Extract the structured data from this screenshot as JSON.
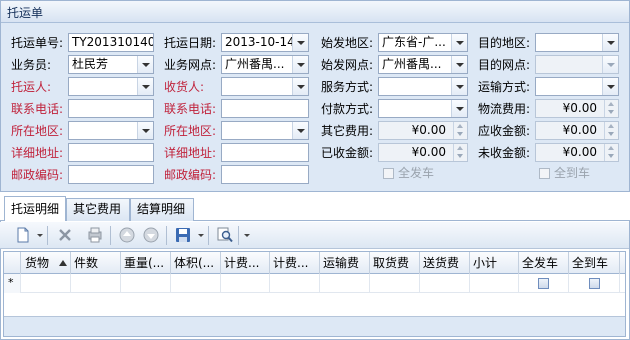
{
  "panel": {
    "title": "托运单"
  },
  "form": {
    "waybill_no_label": "托运单号:",
    "waybill_no_value": "TY201310140",
    "ship_date_label": "托运日期:",
    "ship_date_value": "2013-10-14",
    "origin_region_label": "始发地区:",
    "origin_region_value": "广东省-广...",
    "dest_region_label": "目的地区:",
    "dest_region_value": "",
    "salesman_label": "业务员:",
    "salesman_value": "杜民芳",
    "business_outlet_label": "业务网点:",
    "business_outlet_value": "广州番禺...",
    "origin_outlet_label": "始发网点:",
    "origin_outlet_value": "广州番禺...",
    "dest_outlet_label": "目的网点:",
    "dest_outlet_value": "",
    "shipper_label": "托运人:",
    "shipper_value": "",
    "consignee_label": "收货人:",
    "consignee_value": "",
    "service_mode_label": "服务方式:",
    "service_mode_value": "",
    "transport_mode_label": "运输方式:",
    "transport_mode_value": "",
    "shipper_phone_label": "联系电话:",
    "shipper_phone_value": "",
    "consignee_phone_label": "联系电话:",
    "consignee_phone_value": "",
    "payment_mode_label": "付款方式:",
    "payment_mode_value": "",
    "logistics_fee_label": "物流费用:",
    "logistics_fee_value": "¥0.00",
    "shipper_region_label": "所在地区:",
    "shipper_region_value": "",
    "consignee_region_label": "所在地区:",
    "consignee_region_value": "",
    "other_fee_label": "其它费用:",
    "other_fee_value": "¥0.00",
    "receivable_label": "应收金额:",
    "receivable_value": "¥0.00",
    "shipper_address_label": "详细地址:",
    "shipper_address_value": "",
    "consignee_address_label": "详细地址:",
    "consignee_address_value": "",
    "received_label": "已收金额:",
    "received_value": "¥0.00",
    "uncollected_label": "未收金额:",
    "uncollected_value": "¥0.00",
    "shipper_postcode_label": "邮政编码:",
    "shipper_postcode_value": "",
    "consignee_postcode_label": "邮政编码:",
    "consignee_postcode_value": "",
    "all_shipped_label": "全发车",
    "all_arrived_label": "全到车"
  },
  "tabs": [
    "托运明细",
    "其它费用",
    "结算明细"
  ],
  "toolbar_icons": [
    "new-icon",
    "delete-icon",
    "print-icon",
    "move-up-icon",
    "move-down-icon",
    "save-icon",
    "search-icon"
  ],
  "grid": {
    "columns": [
      "货物",
      "件数",
      "重量(...",
      "体积(...",
      "计费...",
      "计费...",
      "运输费",
      "取货费",
      "送货费",
      "小计",
      "全发车",
      "全到车"
    ],
    "new_row_marker": "*"
  }
}
